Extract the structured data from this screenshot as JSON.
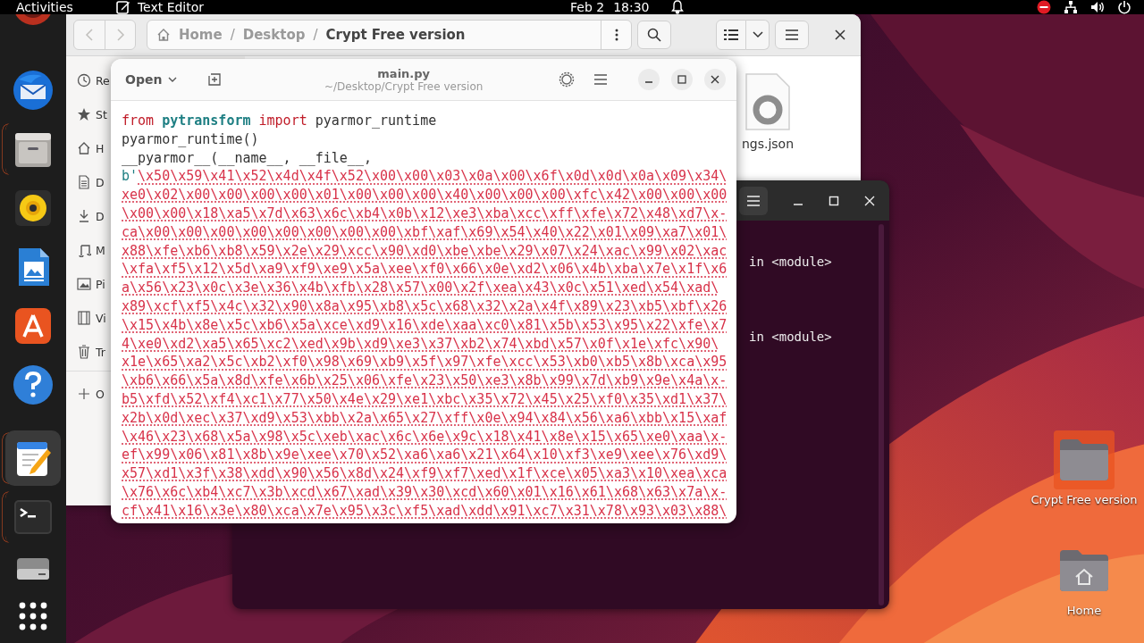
{
  "top_bar": {
    "activities": "Activities",
    "app": "Text Editor",
    "date": "Feb 2",
    "time": "18:30"
  },
  "dock": [
    {
      "kind": "cut",
      "running": false,
      "selected": false
    },
    {
      "kind": "mail",
      "running": false,
      "selected": false
    },
    {
      "kind": "files",
      "running": true,
      "selected": false
    },
    {
      "kind": "music",
      "running": false,
      "selected": false
    },
    {
      "kind": "writer",
      "running": false,
      "selected": false
    },
    {
      "kind": "store",
      "running": false,
      "selected": false
    },
    {
      "kind": "help",
      "running": false,
      "selected": false
    },
    {
      "kind": "editor",
      "running": true,
      "selected": true
    },
    {
      "kind": "terminal",
      "running": true,
      "selected": false
    },
    {
      "kind": "drive",
      "running": false,
      "selected": false
    },
    {
      "kind": "apps",
      "running": false,
      "selected": false
    }
  ],
  "file_manager": {
    "path": [
      "Home",
      "Desktop",
      "Crypt Free version"
    ],
    "path_separator": "/",
    "sidebar": [
      {
        "kind": "recent",
        "label": "Re"
      },
      {
        "kind": "starred",
        "label": "St"
      },
      {
        "kind": "home",
        "label": "H"
      },
      {
        "kind": "documents",
        "label": "D"
      },
      {
        "kind": "downloads",
        "label": "D"
      },
      {
        "kind": "music",
        "label": "M"
      },
      {
        "kind": "pictures",
        "label": "Pi"
      },
      {
        "kind": "videos",
        "label": "Vi"
      },
      {
        "kind": "trash",
        "label": "Tr"
      },
      {
        "kind": "other",
        "label": "O"
      }
    ],
    "files": [
      {
        "name": "ngs.json"
      }
    ]
  },
  "terminal": {
    "lines": [
      {
        "text": "in <module>"
      },
      {
        "text": "in <module>"
      }
    ]
  },
  "editor": {
    "open_label": "Open",
    "title": "main.py",
    "subtitle": "~/Desktop/Crypt Free version",
    "lines": [
      [
        {
          "kind": "keyword",
          "text": "from "
        },
        {
          "kind": "module",
          "text": "pytransform "
        },
        {
          "kind": "keyword",
          "text": "import"
        },
        {
          "kind": "plain",
          "text": " pyarmor_runtime"
        }
      ],
      [
        {
          "kind": "plain",
          "text": "pyarmor_runtime()"
        }
      ],
      [
        {
          "kind": "plain",
          "text": "__pyarmor__(__name__, __file__,"
        }
      ],
      [
        {
          "kind": "prefix",
          "text": "b'"
        },
        {
          "kind": "bytes",
          "text": "\\x50\\x59\\x41\\x52\\x4d\\x4f\\x52\\x00\\x00\\x03\\x0a\\x00\\x6f\\x0d\\x0d\\x0a\\x09\\x34\\"
        }
      ],
      [
        {
          "kind": "bytes",
          "text": "xe0\\x02\\x00\\x00\\x00\\x00\\x01\\x00\\x00\\x00\\x40\\x00\\x00\\x00\\xfc\\x42\\x00\\x00\\x00"
        }
      ],
      [
        {
          "kind": "bytes",
          "text": "\\x00\\x00\\x18\\xa5\\x7d\\x63\\x6c\\xb4\\x0b\\x12\\xe3\\xba\\xcc\\xff\\xfe\\x72\\x48\\xd7\\x-"
        }
      ],
      [
        {
          "kind": "bytes",
          "text": "ca\\x00\\x00\\x00\\x00\\x00\\x00\\x00\\x00\\xbf\\xaf\\x69\\x54\\x40\\x22\\x01\\x09\\xa7\\x01\\"
        }
      ],
      [
        {
          "kind": "bytes",
          "text": "x88\\xfe\\xb6\\xb8\\x59\\x2e\\x29\\xcc\\x90\\xd0\\xbe\\xbe\\x29\\x07\\x24\\xac\\x99\\x02\\xac"
        }
      ],
      [
        {
          "kind": "bytes",
          "text": "\\xfa\\xf5\\x12\\x5d\\xa9\\xf9\\xe9\\x5a\\xee\\xf0\\x66\\x0e\\xd2\\x06\\x4b\\xba\\x7e\\x1f\\x6"
        }
      ],
      [
        {
          "kind": "bytes",
          "text": "a\\x56\\x23\\x0c\\x3e\\x36\\x4b\\xfb\\x28\\x57\\x00\\x2f\\xea\\x43\\x0c\\x51\\xed\\x54\\xad\\"
        }
      ],
      [
        {
          "kind": "bytes",
          "text": "x89\\xcf\\xf5\\x4c\\x32\\x90\\x8a\\x95\\xb8\\x5c\\x68\\x32\\x2a\\x4f\\x89\\x23\\xb5\\xbf\\x26"
        }
      ],
      [
        {
          "kind": "bytes",
          "text": "\\x15\\x4b\\x8e\\x5c\\xb6\\x5a\\xce\\xd9\\x16\\xde\\xaa\\xc0\\x81\\x5b\\x53\\x95\\x22\\xfe\\x7"
        }
      ],
      [
        {
          "kind": "bytes",
          "text": "4\\xe0\\xd2\\xa5\\x65\\xc2\\xed\\x9b\\xd9\\xe3\\x37\\xb2\\x74\\xbd\\x57\\x0f\\x1e\\xfc\\x90\\"
        }
      ],
      [
        {
          "kind": "bytes",
          "text": "x1e\\x65\\xa2\\x5c\\xb2\\xf0\\x98\\x69\\xb9\\x5f\\x97\\xfe\\xcc\\x53\\xb0\\xb5\\x8b\\xca\\x95"
        }
      ],
      [
        {
          "kind": "bytes",
          "text": "\\xb6\\x66\\x5a\\x8d\\xfe\\x6b\\x25\\x06\\xfe\\x23\\x50\\xe3\\x8b\\x99\\x7d\\xb9\\x9e\\x4a\\x-"
        }
      ],
      [
        {
          "kind": "bytes",
          "text": "b5\\xfd\\x52\\xf4\\xc1\\x77\\x50\\x4e\\x29\\xe1\\xbc\\x35\\x72\\x45\\x25\\xf0\\x35\\xd1\\x37\\"
        }
      ],
      [
        {
          "kind": "bytes",
          "text": "x2b\\x0d\\xec\\x37\\xd9\\x53\\xbb\\x2a\\x65\\x27\\xff\\x0e\\x94\\x84\\x56\\xa6\\xbb\\x15\\xaf"
        }
      ],
      [
        {
          "kind": "bytes",
          "text": "\\x46\\x23\\x68\\x5a\\x98\\x5c\\xeb\\xac\\x6c\\x6e\\x9c\\x18\\x41\\x8e\\x15\\x65\\xe0\\xaa\\x-"
        }
      ],
      [
        {
          "kind": "bytes",
          "text": "ef\\x99\\x06\\x81\\x8b\\x9e\\xee\\x70\\x52\\xa6\\xa6\\x21\\x64\\x10\\xf3\\xe9\\xee\\x76\\xd9\\"
        }
      ],
      [
        {
          "kind": "bytes",
          "text": "x57\\xd1\\x3f\\x38\\xdd\\x90\\x56\\x8d\\x24\\xf9\\xf7\\xed\\x1f\\xce\\x05\\xa3\\x10\\xea\\xca"
        }
      ],
      [
        {
          "kind": "bytes",
          "text": "\\x76\\x6c\\xb4\\xc7\\x3b\\xcd\\x67\\xad\\x39\\x30\\xcd\\x60\\x01\\x16\\x61\\x68\\x63\\x7a\\x-"
        }
      ],
      [
        {
          "kind": "bytes",
          "text": "cf\\x41\\x16\\x3e\\x80\\xca\\x7e\\x95\\x3c\\xf5\\xad\\xdd\\x91\\xc7\\x31\\x78\\x93\\x03\\x88\\"
        }
      ]
    ]
  },
  "desktop_icons": [
    {
      "kind": "folder",
      "label": "Crypt Free version",
      "selected": true
    },
    {
      "kind": "home",
      "label": "Home",
      "selected": false
    }
  ]
}
